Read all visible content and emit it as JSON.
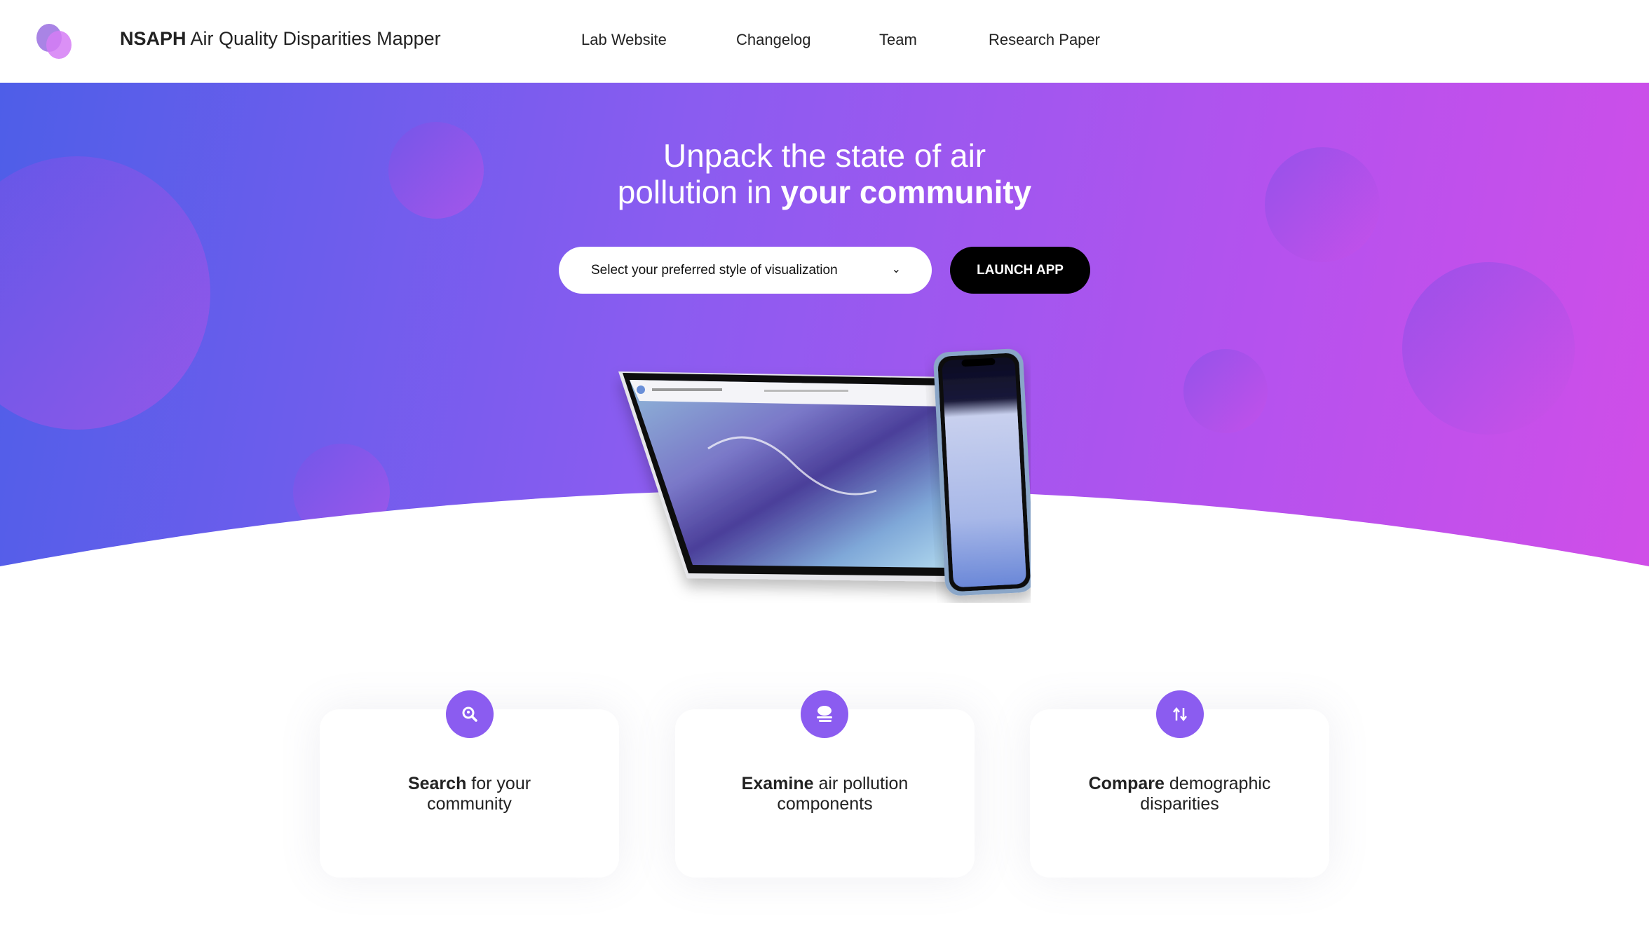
{
  "header": {
    "brand_bold": "NSAPH",
    "brand_rest": " Air Quality Disparities Mapper",
    "nav": [
      {
        "label": "Lab Website"
      },
      {
        "label": "Changelog"
      },
      {
        "label": "Team"
      },
      {
        "label": "Research Paper"
      }
    ]
  },
  "hero": {
    "line1": "Unpack the state of air",
    "line2_plain": "pollution in ",
    "line2_bold": "your community",
    "select_value": "Select your preferred style of visualization",
    "launch_label": "LAUNCH APP"
  },
  "features": [
    {
      "bold": "Search",
      "rest": " for your",
      "line2": "community",
      "icon": "search-location-icon"
    },
    {
      "bold": "Examine",
      "rest": " air pollution",
      "line2": "components",
      "icon": "smog-cloud-icon"
    },
    {
      "bold": "Compare",
      "rest": " demographic",
      "line2": "disparities",
      "icon": "compare-arrows-icon"
    }
  ],
  "colors": {
    "accent": "#8b5cf0",
    "gradient_start": "#4e5ee8",
    "gradient_end": "#d04ee8",
    "button": "#000000"
  }
}
